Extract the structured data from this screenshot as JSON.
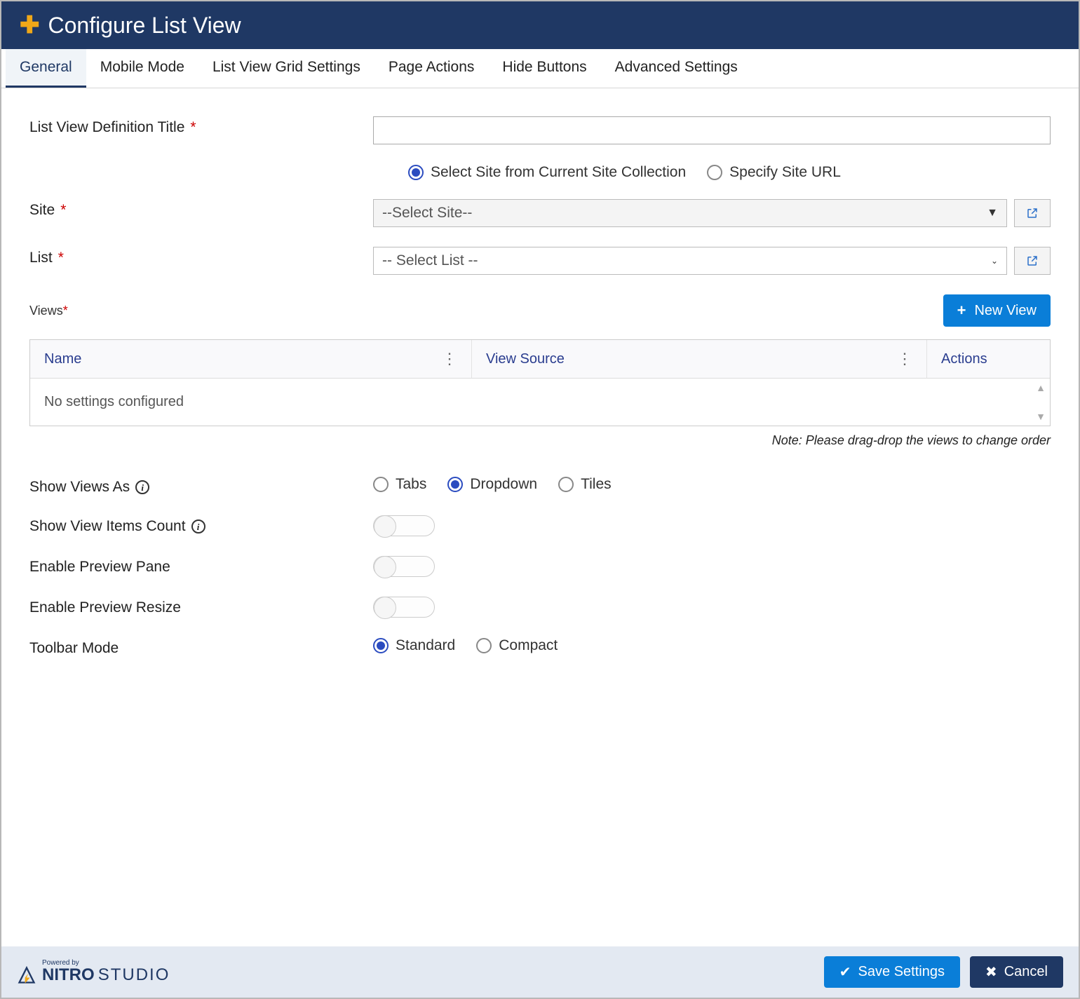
{
  "header": {
    "title": "Configure List View"
  },
  "tabs": [
    "General",
    "Mobile Mode",
    "List View Grid Settings",
    "Page Actions",
    "Hide Buttons",
    "Advanced Settings"
  ],
  "active_tab": 0,
  "form": {
    "definition_title_label": "List View Definition Title",
    "site_selection": {
      "options": [
        "Select Site from Current Site Collection",
        "Specify Site URL"
      ],
      "selected": 0
    },
    "site_label": "Site",
    "site_value": "--Select Site--",
    "list_label": "List",
    "list_value": "-- Select List --",
    "views_label": "Views",
    "new_view_btn": "New View",
    "grid": {
      "columns": [
        "Name",
        "View Source",
        "Actions"
      ],
      "empty": "No settings configured"
    },
    "note": "Note: Please drag-drop the views to change order",
    "show_views_as_label": "Show Views As",
    "show_views_as_options": [
      "Tabs",
      "Dropdown",
      "Tiles"
    ],
    "show_views_as_selected": 1,
    "show_count_label": "Show View Items Count",
    "preview_pane_label": "Enable Preview Pane",
    "preview_resize_label": "Enable Preview Resize",
    "toolbar_label": "Toolbar Mode",
    "toolbar_options": [
      "Standard",
      "Compact"
    ],
    "toolbar_selected": 0
  },
  "footer": {
    "powered": "Powered by",
    "brand1": "NITRO",
    "brand2": "STUDIO",
    "save": "Save Settings",
    "cancel": "Cancel"
  }
}
